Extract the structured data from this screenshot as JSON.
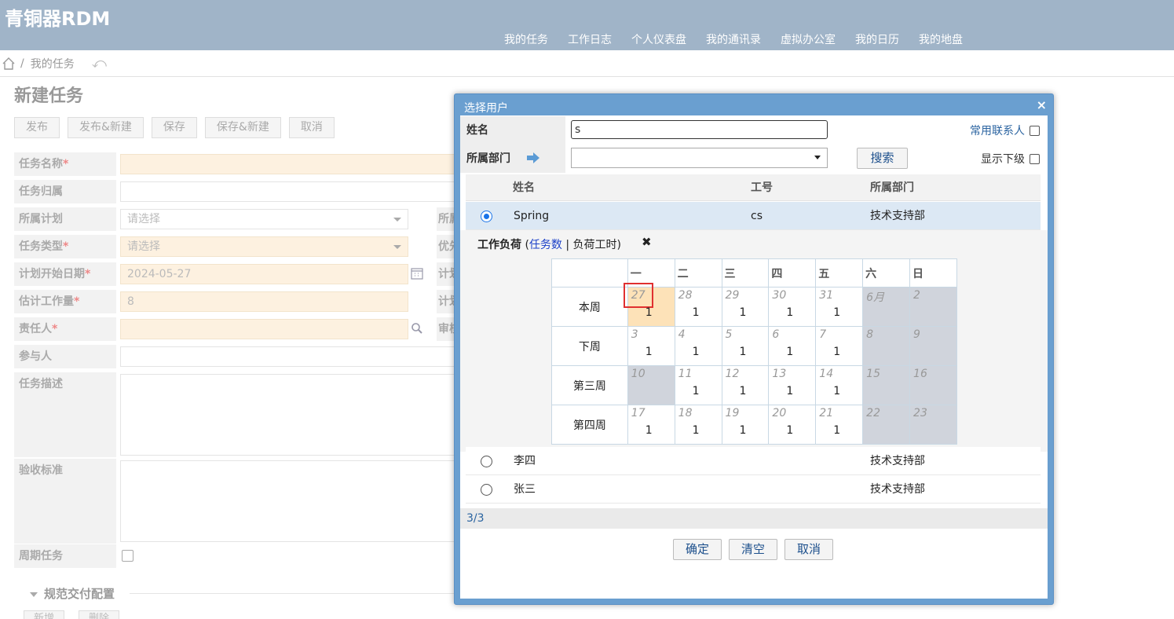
{
  "app": {
    "logo": "青铜器RDM"
  },
  "topnav": [
    "我的任务",
    "工作日志",
    "个人仪表盘",
    "我的通讯录",
    "虚拟办公室",
    "我的日历",
    "我的地盘"
  ],
  "breadcrumb": {
    "current": "我的任务"
  },
  "form": {
    "title": "新建任务",
    "toolbar": [
      "发布",
      "发布&新建",
      "保存",
      "保存&新建",
      "取消"
    ],
    "fields": {
      "task_name": "任务名称",
      "task_owner": "任务归属",
      "plan": "所属计划",
      "plan_placeholder": "请选择",
      "task_type": "任务类型",
      "type_placeholder": "请选择",
      "start_date": "计划开始日期",
      "start_date_value": "2024-05-27",
      "effort": "估计工作量",
      "effort_value": "8",
      "assignee": "责任人",
      "participants": "参与人",
      "description": "任务描述",
      "acceptance": "验收标准",
      "recurring": "周期任务",
      "right_col": [
        "所属",
        "优先",
        "计划",
        "计划",
        "审核"
      ]
    },
    "required_mark": "*",
    "section": "规范交付配置",
    "bottom_buttons": [
      "新增",
      "删除"
    ]
  },
  "dialog": {
    "title": "选择用户",
    "close": "×",
    "search": {
      "name_label": "姓名",
      "name_value": "s",
      "dept_label": "所属部门",
      "frequent_contacts": "常用联系人",
      "show_sub": "显示下级",
      "search_button": "搜索"
    },
    "columns": [
      "姓名",
      "工号",
      "所属部门"
    ],
    "users": [
      {
        "name": "Spring",
        "id": "cs",
        "dept": "技术支持部",
        "selected": true
      },
      {
        "name": "李四",
        "id": "",
        "dept": "技术支持部",
        "selected": false
      },
      {
        "name": "张三",
        "id": "",
        "dept": "技术支持部",
        "selected": false
      }
    ],
    "workload": {
      "label": "工作负荷",
      "open_paren": "(",
      "link_tasks": "任务数",
      "divider": " | ",
      "link_hours": "负荷工时",
      "close_paren": ")",
      "close": "✖",
      "weekdays": [
        "一",
        "二",
        "三",
        "四",
        "五",
        "六",
        "日"
      ],
      "weeks": [
        {
          "label": "本周",
          "days": [
            "27",
            "28",
            "29",
            "30",
            "31",
            "6月",
            "2"
          ],
          "counts": [
            "1",
            "1",
            "1",
            "1",
            "1",
            "",
            ""
          ]
        },
        {
          "label": "下周",
          "days": [
            "3",
            "4",
            "5",
            "6",
            "7",
            "8",
            "9"
          ],
          "counts": [
            "1",
            "1",
            "1",
            "1",
            "1",
            "",
            ""
          ]
        },
        {
          "label": "第三周",
          "days": [
            "10",
            "11",
            "12",
            "13",
            "14",
            "15",
            "16"
          ],
          "counts": [
            "",
            "1",
            "1",
            "1",
            "1",
            "",
            ""
          ]
        },
        {
          "label": "第四周",
          "days": [
            "17",
            "18",
            "19",
            "20",
            "21",
            "22",
            "23"
          ],
          "counts": [
            "1",
            "1",
            "1",
            "1",
            "1",
            "",
            ""
          ]
        }
      ]
    },
    "pager": "3/3",
    "buttons": [
      "确定",
      "清空",
      "取消"
    ]
  }
}
